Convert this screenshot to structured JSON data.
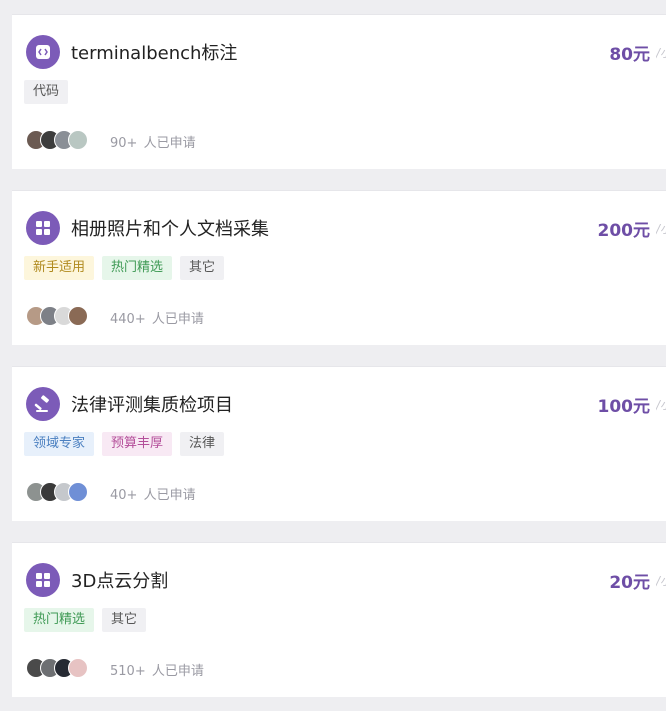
{
  "tasks": [
    {
      "icon": "code-icon",
      "title": "terminalbench标注",
      "price": "80元",
      "price_suffix": "/小",
      "tags": [
        {
          "label": "代码",
          "bg": "#f0f0f3",
          "fg": "#555555"
        }
      ],
      "avatar_colors": [
        "#6b5a52",
        "#3d3d3d",
        "#8a8f96",
        "#b9c7c2"
      ],
      "applicant_count": "90+",
      "applicant_text": "人已申请"
    },
    {
      "icon": "grid-icon",
      "title": "相册照片和个人文档采集",
      "price": "200元",
      "price_suffix": "/小",
      "tags": [
        {
          "label": "新手适用",
          "bg": "#fdf6dc",
          "fg": "#b08a1e"
        },
        {
          "label": "热门精选",
          "bg": "#e6f6ea",
          "fg": "#3f9a55"
        },
        {
          "label": "其它",
          "bg": "#f0f0f3",
          "fg": "#555555"
        }
      ],
      "avatar_colors": [
        "#b69a86",
        "#7d8087",
        "#d9d9d9",
        "#8a6a55"
      ],
      "applicant_count": "440+",
      "applicant_text": "人已申请"
    },
    {
      "icon": "gavel-icon",
      "title": "法律评测集质检项目",
      "price": "100元",
      "price_suffix": "/小",
      "tags": [
        {
          "label": "领域专家",
          "bg": "#e7f0fb",
          "fg": "#4a7fc0"
        },
        {
          "label": "预算丰厚",
          "bg": "#f8e9f4",
          "fg": "#b44f9a"
        },
        {
          "label": "法律",
          "bg": "#f0f0f3",
          "fg": "#555555"
        }
      ],
      "avatar_colors": [
        "#8d9290",
        "#3a3a3a",
        "#c5c8cc",
        "#6f8fd6"
      ],
      "applicant_count": "40+",
      "applicant_text": "人已申请"
    },
    {
      "icon": "grid-icon",
      "title": "3D点云分割",
      "price": "20元",
      "price_suffix": "/小",
      "tags": [
        {
          "label": "热门精选",
          "bg": "#e6f6ea",
          "fg": "#3f9a55"
        },
        {
          "label": "其它",
          "bg": "#f0f0f3",
          "fg": "#555555"
        }
      ],
      "avatar_colors": [
        "#4a4a4a",
        "#6d6f72",
        "#262a33",
        "#e7c3c3"
      ],
      "applicant_count": "510+",
      "applicant_text": "人已申请"
    }
  ]
}
